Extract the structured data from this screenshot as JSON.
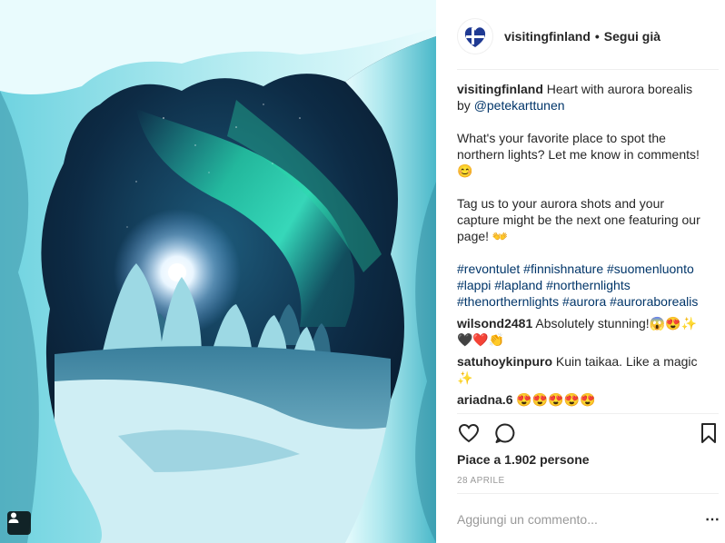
{
  "post": {
    "account": "visitingfinland",
    "follow_label": "Segui già",
    "separator": "•",
    "caption": {
      "text": "Heart with aurora borealis by",
      "mention": "@petekarttunen",
      "paragraph2": "What's your favorite place to spot the northern lights? Let me know in comments! 😊",
      "paragraph3": "Tag us to your aurora shots and your capture might be the next one featuring our page! 👐",
      "hashtags": [
        "#revontulet",
        "#finnishnature",
        "#suomenluonto",
        "#lappi",
        "#lapland",
        "#northernlights",
        "#thenorthernlights",
        "#aurora",
        "#auroraborealis"
      ]
    },
    "comments": [
      {
        "user": "wilsond2481",
        "text": "Absolutely stunning!😱😍✨🖤❤️👏"
      },
      {
        "user": "satuhoykinpuro",
        "text": "Kuin taikaa. Like a magic ✨"
      },
      {
        "user": "ariadna.6",
        "text": "😍😍😍😍😍"
      }
    ],
    "likes_text": "Piace a 1.902 persone",
    "date": "28 APRILE",
    "add_comment_placeholder": "Aggiungi un commento...",
    "more_icon": "⋯"
  },
  "icons": {
    "avatar": "finland-heart-logo",
    "like": "heart-icon",
    "comment": "comment-bubble-icon",
    "save": "bookmark-icon",
    "tag": "user-tag-icon"
  },
  "colors": {
    "link": "#003569",
    "hashtag": "#003569",
    "text": "#262626",
    "muted": "#999999",
    "divider": "#efefef",
    "aurora": "#2fe0b8",
    "logo_blue": "#1f3a93"
  }
}
